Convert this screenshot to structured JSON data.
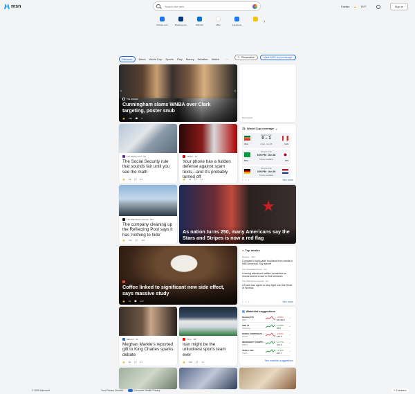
{
  "header": {
    "logo": "msn",
    "search_placeholder": "Search the web",
    "location": "Fairfax",
    "weather": "75°F",
    "signin": "Sign in"
  },
  "quicklinks": [
    {
      "label": "Outlook.com",
      "color": "#1a73e8"
    },
    {
      "label": "Booking.com",
      "color": "#003580"
    },
    {
      "label": "Walmart",
      "color": "#0071ce"
    },
    {
      "label": "eBay",
      "color": "#e53238"
    },
    {
      "label": "Facebook",
      "color": "#1877f2"
    },
    {
      "label": "",
      "color": "#f4c20d"
    }
  ],
  "nav": {
    "tabs": [
      "Discover",
      "News",
      "World Cup",
      "Sports",
      "Play",
      "Money",
      "Weather",
      "Watch"
    ],
    "more": "···",
    "personalize": "Personalize",
    "homepage": "Make MSN my homepage"
  },
  "hero": {
    "source": "The Athletic",
    "title": "Cunningham slams WNBA over Clark targeting, poster snub",
    "likes": "790",
    "comments": "6"
  },
  "ad": {
    "label": "Sponsored"
  },
  "cards": [
    {
      "id": "ssa",
      "source": "The Motley Fool · 3d",
      "title": "The Social Security rule that sounds fair until you see the math",
      "likes": "49",
      "comments": "16"
    },
    {
      "id": "phone",
      "source": "ZDNet · 1d",
      "title": "Your phone has a hidden defense against scam texts—and it's probably turned off",
      "likes": "14",
      "comments": "11"
    },
    {
      "id": "pool",
      "source": "The Wall Street Journal · 14h",
      "title": "The company cleaning up the Reflecting Pool says it has 'nothing to hide'",
      "likes": "746",
      "comments": "107"
    },
    {
      "id": "flag",
      "source": "",
      "title": "As nation turns 250, many Americans say the Stars and Stripes is now a red flag",
      "likes": "",
      "comments": ""
    },
    {
      "id": "coffee",
      "source": "",
      "title": "Coffee linked to significant new side effect, says massive study",
      "likes": "31",
      "comments": "107"
    },
    {
      "id": "meghan",
      "source": "HELLO! · 4h",
      "title": "Meghan Markle's reported gift to King Charles sparks debate",
      "likes": "48",
      "comments": "17"
    },
    {
      "id": "iran",
      "source": "Time · 19h",
      "title": "Iran might be the unluckiest sports team ever",
      "likes": "339",
      "comments": "12"
    }
  ],
  "worldcup": {
    "title": "World Cup coverage",
    "matches": [
      {
        "round": "Round of 32",
        "score": "0 – 1",
        "note": "Final · Jun 28",
        "team1": "RSA",
        "team2": "CAN"
      },
      {
        "round": "Round of 32",
        "score": "6:00 PM · Jun 28",
        "note": "Tickets available",
        "team1": "BRA",
        "team2": "JPN"
      },
      {
        "round": "Round of 32",
        "score": "3:00 PM · Jun 29",
        "note": "Tickets available",
        "team1": "GER",
        "team2": "NED"
      }
    ],
    "see_more": "See more"
  },
  "topstories": {
    "title": "Top stories",
    "items": [
      {
        "source": "Reuters · 34m",
        "text": "Comcast to split cable business from media in NBCUniversal, Sky spinoff"
      },
      {
        "source": "The Associated Press · 5m",
        "text": "A strong aftershock rattles Venezuela as rescue workers race to find survivors"
      },
      {
        "source": "The Wall Street Journal · 3m",
        "text": "US and Iran agree to stop fight over the Strait of Hormuz"
      }
    ],
    "see_more": "See more"
  },
  "watchlist": {
    "title": "Watchlist suggestions",
    "rows": [
      {
        "name": "Nasdaq 100",
        "sub": "NDX",
        "change": "-0.06%",
        "price": "26,050.8",
        "dir": "down"
      },
      {
        "name": "S&P 75",
        "sub": "Shipping",
        "change": "+0.56%",
        "price": "95.8",
        "dir": "up"
      },
      {
        "name": "NVIDIA CORPORATI...",
        "sub": "NVDA",
        "change": "-0.83%",
        "price": "166.5",
        "dir": "down"
      },
      {
        "name": "MICROSOFT CORPO...",
        "sub": "MSFT",
        "change": "+0.77%",
        "price": "472.6",
        "dir": "up"
      },
      {
        "name": "TESLA, INC.",
        "sub": "TSLA",
        "change": "+0.34%",
        "price": "327.1",
        "dir": "up"
      }
    ],
    "see_more": "See watchlist suggestions"
  },
  "footer": {
    "copyright": "© 2026 Microsoft",
    "privacy": "Your Privacy Choices",
    "health": "Consumer Health Privacy",
    "feedback": "Feedback"
  }
}
